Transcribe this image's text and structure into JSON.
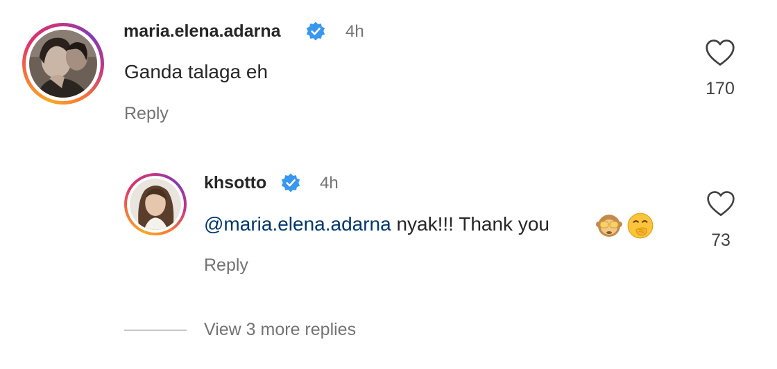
{
  "comments": [
    {
      "username": "maria.elena.adarna",
      "time": "4h",
      "text": "Ganda talaga eh",
      "reply_label": "Reply",
      "likes": "170",
      "verified": true,
      "avatar": "user-avatar-photo"
    }
  ],
  "replies": [
    {
      "username": "khsotto",
      "time": "4h",
      "mention": "@maria.elena.adarna",
      "text": " nyak!!! Thank you",
      "emojis": [
        "see-no-evil-monkey",
        "face-with-hand-over-mouth"
      ],
      "reply_label": "Reply",
      "likes": "73",
      "verified": true,
      "avatar": "user-avatar-photo"
    }
  ],
  "view_more_label": "View 3 more replies",
  "colors": {
    "verified_blue": "#3897f0",
    "mention": "#00376b",
    "secondary_text": "#737373"
  }
}
